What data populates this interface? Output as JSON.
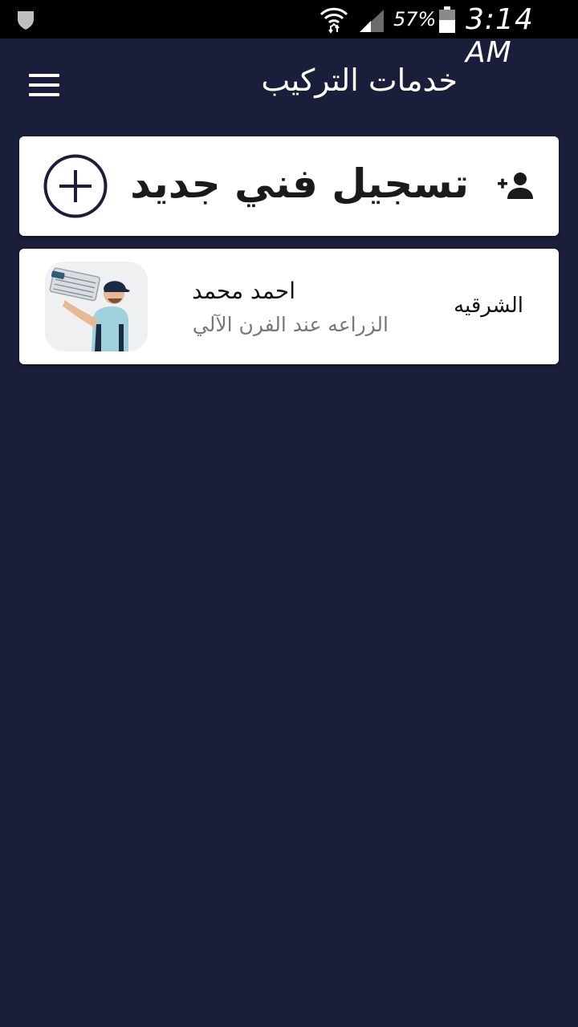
{
  "status_bar": {
    "battery_percent": "57%",
    "time": "3:14 AM",
    "icons": [
      "shield-icon",
      "wifi-icon",
      "signal-icon",
      "battery-icon"
    ]
  },
  "app_bar": {
    "title": "خدمات التركيب",
    "menu_icon": "hamburger-menu-icon"
  },
  "register_card": {
    "label": "تسجيل فني جديد",
    "leading_icon": "add-person-icon",
    "action_icon": "plus-circle-icon"
  },
  "technicians": [
    {
      "name": "احمد محمد",
      "address": "الزراعه عند الفرن الآلي",
      "region": "الشرقيه",
      "avatar_icon": "technician-photo"
    }
  ],
  "colors": {
    "background": "#1a1e3a",
    "card": "#ffffff",
    "status_bar": "#000000",
    "primary_text": "#111111",
    "secondary_text": "#777777"
  }
}
